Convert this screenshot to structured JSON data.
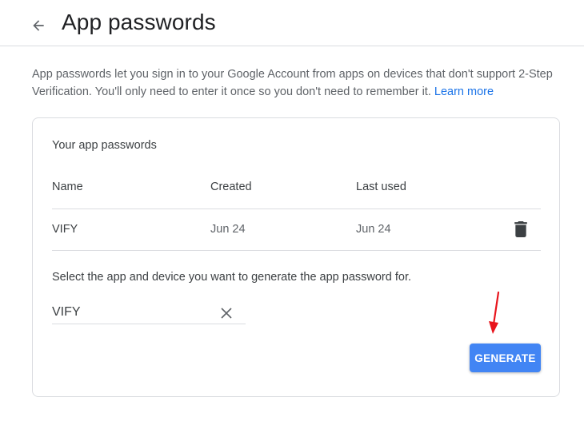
{
  "header": {
    "title": "App passwords",
    "back_icon": "arrow-left-icon"
  },
  "description": {
    "text": "App passwords let you sign in to your Google Account from apps on devices that don't support 2-Step Verification. You'll only need to enter it once so you don't need to remember it. ",
    "learn_more": "Learn more"
  },
  "card": {
    "heading": "Your app passwords",
    "columns": {
      "name": "Name",
      "created": "Created",
      "last_used": "Last used"
    },
    "rows": [
      {
        "name": "VIFY",
        "created": "Jun 24",
        "last_used": "Jun 24",
        "action_icon": "trash-icon"
      }
    ],
    "select_label": "Select the app and device you want to generate the app password for.",
    "input": {
      "value": "VIFY",
      "clear_icon": "close-icon"
    },
    "generate_label": "GENERATE"
  },
  "colors": {
    "accent": "#4285f4",
    "link": "#1a73e8",
    "annotation": "#e8141c",
    "divider": "#dadce0"
  }
}
